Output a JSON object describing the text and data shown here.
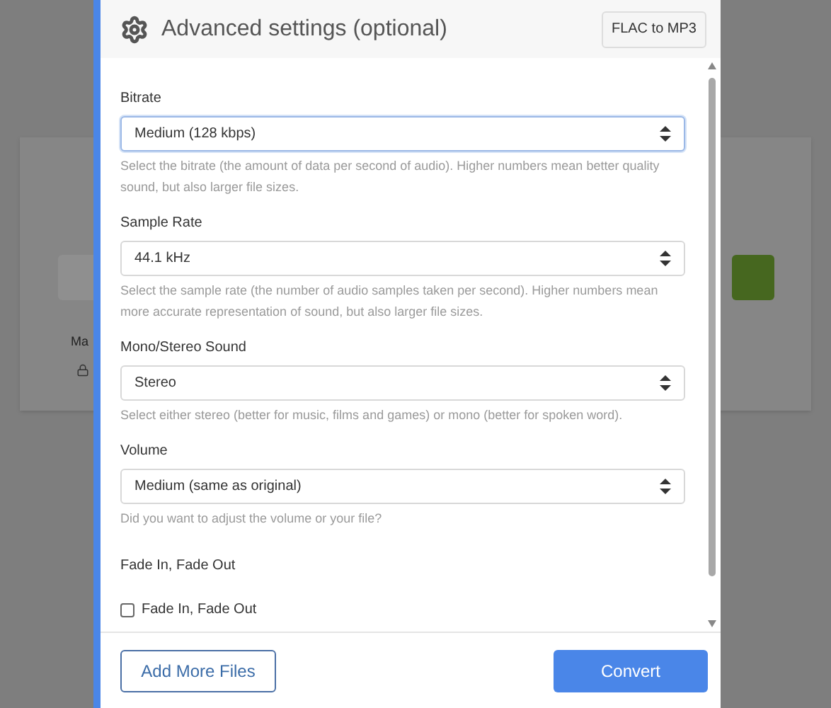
{
  "background_page": {
    "text": "Ma"
  },
  "dialog": {
    "title": "Advanced settings (optional)",
    "format_button": "FLAC to MP3",
    "settings": [
      {
        "kind": "select",
        "label": "Bitrate",
        "value": "Medium (128 kbps)",
        "focused": true,
        "help": "Select the bitrate (the amount of data per second of audio). Higher numbers mean better quality sound, but also larger file sizes."
      },
      {
        "kind": "select",
        "label": "Sample Rate",
        "value": "44.1 kHz",
        "focused": false,
        "help": "Select the sample rate (the number of audio samples taken per second). Higher numbers mean more accurate representation of sound, but also larger file sizes."
      },
      {
        "kind": "select",
        "label": "Mono/Stereo Sound",
        "value": "Stereo",
        "focused": false,
        "help": "Select either stereo (better for music, films and games) or mono (better for spoken word)."
      },
      {
        "kind": "select",
        "label": "Volume",
        "value": "Medium (same as original)",
        "focused": false,
        "help": "Did you want to adjust the volume or your file?"
      },
      {
        "kind": "checkbox",
        "label": "Fade In, Fade Out",
        "option": "Fade In, Fade Out",
        "checked": false
      }
    ],
    "buttons": [
      {
        "kind": "secondary",
        "label": "Add More Files"
      },
      {
        "kind": "primary",
        "label": "Convert"
      }
    ]
  }
}
